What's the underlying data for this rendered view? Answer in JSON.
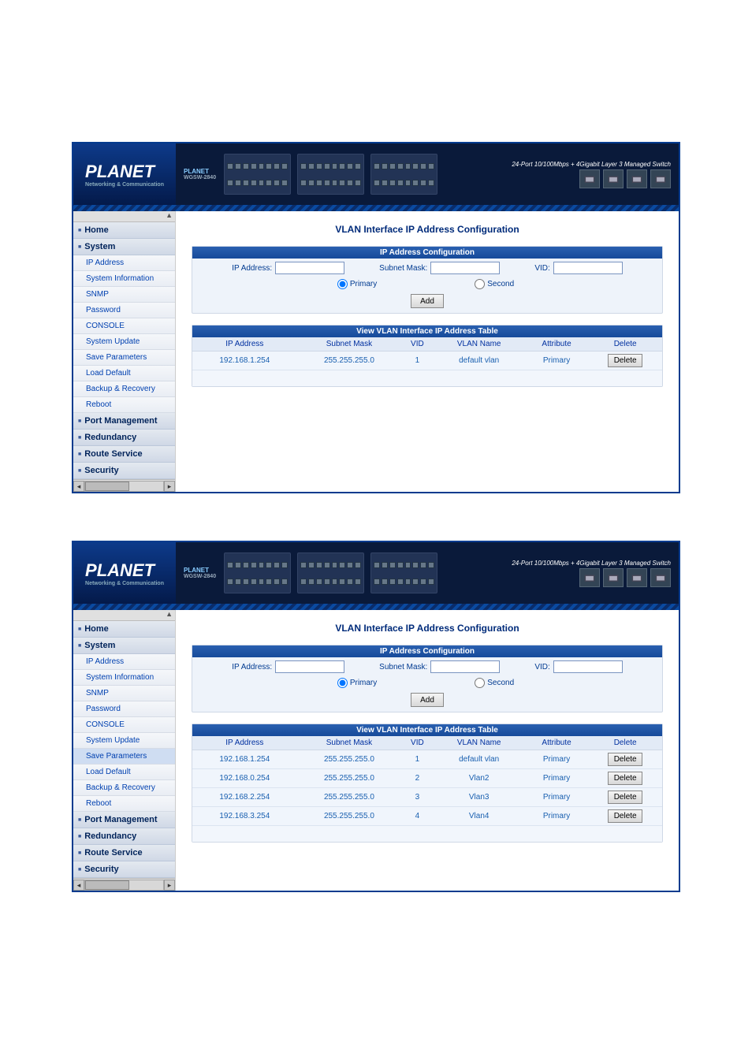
{
  "banner": {
    "brand": "PLANET",
    "tag": "Networking & Communication",
    "sub_logo": "PLANET",
    "model": "WGSW-2840",
    "slogan": "24-Port 10/100Mbps + 4Gigabit Layer 3 Managed Switch"
  },
  "nav": {
    "home": "Home",
    "system": "System",
    "system_items": [
      "IP Address",
      "System Information",
      "SNMP",
      "Password",
      "CONSOLE",
      "System Update",
      "Save Parameters",
      "Load Default",
      "Backup & Recovery",
      "Reboot"
    ],
    "port_mgmt": "Port Management",
    "redundancy": "Redundancy",
    "route_service": "Route Service",
    "security": "Security"
  },
  "main": {
    "title": "VLAN Interface IP Address Configuration",
    "cfg_header": "IP Address Configuration",
    "ip_label": "IP Address:",
    "mask_label": "Subnet Mask:",
    "vid_label": "VID:",
    "primary": "Primary",
    "second": "Second",
    "add": "Add",
    "tbl_header": "View VLAN Interface IP Address Table",
    "cols": [
      "IP Address",
      "Subnet Mask",
      "VID",
      "VLAN Name",
      "Attribute",
      "Delete"
    ],
    "delete": "Delete"
  },
  "shot1_rows": [
    {
      "ip": "192.168.1.254",
      "mask": "255.255.255.0",
      "vid": "1",
      "name": "default vlan",
      "attr": "Primary"
    }
  ],
  "shot2_rows": [
    {
      "ip": "192.168.1.254",
      "mask": "255.255.255.0",
      "vid": "1",
      "name": "default vlan",
      "attr": "Primary"
    },
    {
      "ip": "192.168.0.254",
      "mask": "255.255.255.0",
      "vid": "2",
      "name": "Vlan2",
      "attr": "Primary"
    },
    {
      "ip": "192.168.2.254",
      "mask": "255.255.255.0",
      "vid": "3",
      "name": "Vlan3",
      "attr": "Primary"
    },
    {
      "ip": "192.168.3.254",
      "mask": "255.255.255.0",
      "vid": "4",
      "name": "Vlan4",
      "attr": "Primary"
    }
  ]
}
